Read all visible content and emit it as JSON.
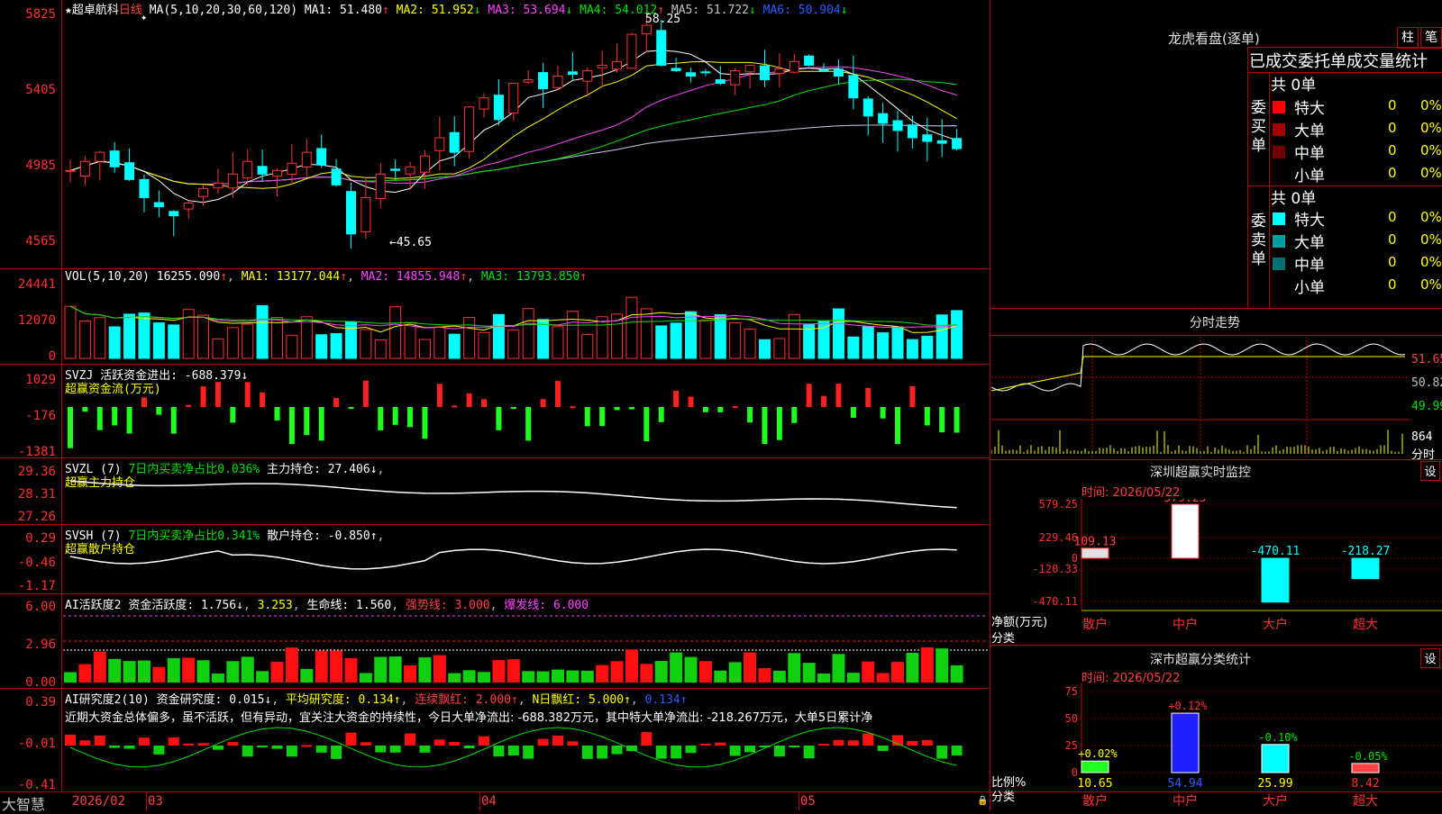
{
  "title": "超卓航科",
  "period": "日线",
  "price_panel": {
    "ma_label": "MA(5,10,20,30,60,120)",
    "ma": [
      {
        "name": "MA1:",
        "value": "51.480",
        "arrow": "↑",
        "color": "#ffffff"
      },
      {
        "name": "MA2:",
        "value": "51.952",
        "arrow": "↓",
        "color": "#ffff00"
      },
      {
        "name": "MA3:",
        "value": "53.694",
        "arrow": "↓",
        "color": "#ff44ff"
      },
      {
        "name": "MA4:",
        "value": "54.012",
        "arrow": "↑",
        "color": "#00e000"
      },
      {
        "name": "MA5:",
        "value": "51.722",
        "arrow": "↓",
        "color": "#c0c0c0"
      },
      {
        "name": "MA6:",
        "value": "50.904",
        "arrow": "↓",
        "color": "#2c5cff"
      }
    ],
    "y_ticks": [
      "5825",
      "5405",
      "4985",
      "4565"
    ],
    "high_label": "58.25",
    "low_label": "←45.65"
  },
  "vol_panel": {
    "label": "VOL(5,10,20)",
    "value": "16255.090",
    "ma1": "MA1: 13177.044",
    "ma2": "MA2: 14855.948",
    "ma3": "MA3: 13793.850",
    "y_ticks": [
      "24441",
      "12070",
      "0"
    ]
  },
  "svzj_panel": {
    "label": "SVZJ  活跃资金进出: -688.379↓",
    "sub": "超赢资金流(万元)",
    "y_ticks": [
      "1029",
      "-176",
      "-1381"
    ]
  },
  "svzl_panel": {
    "label": "SVZL (7)",
    "ratio": "7日内买卖净占比0.036%",
    "hold": "主力持仓: 27.406↓",
    "sub": "超赢主力持仓",
    "y_ticks": [
      "29.36",
      "28.31",
      "27.26"
    ]
  },
  "svsh_panel": {
    "label": "SVSH (7)",
    "ratio": "7日内买卖净占比0.341%",
    "hold": "散户持仓: -0.850↑",
    "sub": "超赢散户持仓",
    "y_ticks": [
      "0.29",
      "-0.46",
      "-1.17"
    ]
  },
  "ai_active_panel": {
    "label": "AI活跃度2",
    "v1": "资金活跃度: 1.756↓",
    "v2": "3.253",
    "v3": "生命线: 1.560",
    "v4": "强势线: 3.000",
    "v5": "爆发线: 6.000",
    "y_ticks": [
      "6.00",
      "2.96",
      "0.00"
    ]
  },
  "ai_research_panel": {
    "label": "AI研究度2(10)",
    "v1": "资金研究度: 0.015↓",
    "v2": "平均研究度: 0.134↑",
    "v3": "连续飘红: 2.000↑",
    "v4": "N日飘红: 5.000↑",
    "v5": "0.134↑",
    "desc": "近期大资金总体偏多，虽不活跃，但有异动，宜关注大资金的持续性，今日大单净流出: -688.382万元，其中特大单净流出: -218.267万元，大单5日累计净",
    "y_ticks": [
      "0.39",
      "-0.01",
      "-0.41"
    ]
  },
  "time_axis": {
    "logo": "大智慧",
    "labels": [
      "2026/02",
      "03",
      "04",
      "05"
    ]
  },
  "right_panel": {
    "dragon_title": "龙虎看盘(逐单)",
    "btn_bar": "柱",
    "btn_stroke": "笔",
    "header": "已成交委托单成交量统计",
    "buy": {
      "side": "委买单",
      "total": "共 0单",
      "rows": [
        {
          "name": "特大",
          "count": "0",
          "pct": "0%",
          "color": "#ff0000"
        },
        {
          "name": "大单",
          "count": "0",
          "pct": "0%",
          "color": "#a00000"
        },
        {
          "name": "中单",
          "count": "0",
          "pct": "0%",
          "color": "#700000"
        },
        {
          "name": "小单",
          "count": "0",
          "pct": "0%",
          "color": "#000000"
        }
      ]
    },
    "sell": {
      "side": "委卖单",
      "total": "共 0单",
      "rows": [
        {
          "name": "特大",
          "count": "0",
          "pct": "0%",
          "color": "#00ffff"
        },
        {
          "name": "大单",
          "count": "0",
          "pct": "0%",
          "color": "#00a0a0"
        },
        {
          "name": "中单",
          "count": "0",
          "pct": "0%",
          "color": "#007070"
        },
        {
          "name": "小单",
          "count": "0",
          "pct": "0%",
          "color": "#000000"
        }
      ]
    },
    "intraday": {
      "title": "分时走势",
      "y_labels": [
        "51.65",
        "50.82",
        "49.99"
      ],
      "vol_label": "864",
      "vol_unit": "分时"
    },
    "monitor": {
      "title": "深圳超赢实时监控",
      "btn": "设",
      "time": "时间: 2026/05/22",
      "y_ticks": [
        "579.25",
        "229.46",
        "0",
        "-120.33",
        "-470.11"
      ],
      "unit_label": "净额(万元)",
      "cat_label": "分类",
      "categories": [
        "散户",
        "中户",
        "大户",
        "超大"
      ],
      "values": [
        109.13,
        579.25,
        -470.11,
        -218.27
      ],
      "value_labels": [
        "109.13",
        "579.25",
        "-470.11",
        "-218.27"
      ]
    },
    "classify": {
      "title": "深市超赢分类统计",
      "btn": "设",
      "time": "时间: 2026/05/22",
      "y_ticks": [
        "75",
        "50",
        "25",
        "0"
      ],
      "unit_label": "比例%",
      "cat_label": "分类",
      "categories": [
        "散户",
        "中户",
        "大户",
        "超大"
      ],
      "values": [
        10.65,
        54.94,
        25.99,
        8.42
      ],
      "change_labels": [
        "+0.02%",
        "+0.12%",
        "-0.10%",
        "-0.05%"
      ]
    }
  }
}
